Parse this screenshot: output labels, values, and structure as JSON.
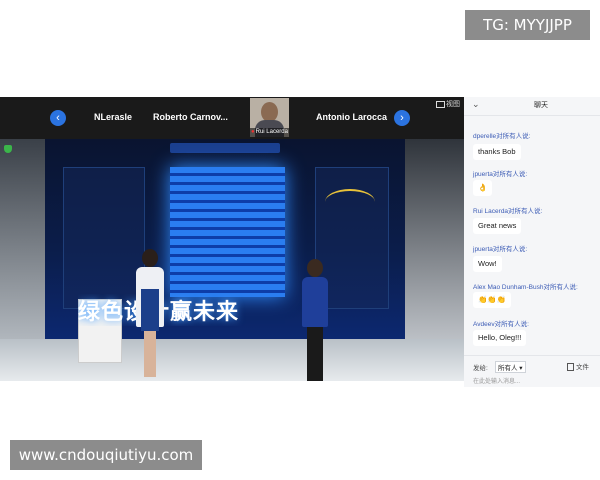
{
  "watermarks": {
    "top": "TG: MYYJJPP",
    "bottom": "www.cndouqiutiyu.com"
  },
  "participants": {
    "prev_icon": "chevron-left-icon",
    "next_icon": "chevron-right-icon",
    "names": [
      "NLerasle",
      "Roberto  Carnov...",
      "Antonio Larocca"
    ],
    "active_speaker": "Rui Lacerda",
    "view_label": "视图"
  },
  "presentation": {
    "slogan": "绿色设计赢未来"
  },
  "chat": {
    "title": "聊天",
    "messages": [
      {
        "sender": "dperelle对所有人说:",
        "text": "thanks Bob"
      },
      {
        "sender": "jpuerta对所有人说:",
        "text": "👌"
      },
      {
        "sender": "Rui Lacerda对所有人说:",
        "text": "Great news"
      },
      {
        "sender": "jpuerta对所有人说:",
        "text": "Wow!"
      },
      {
        "sender": "Alex Mao Dunham-Bush对所有人说:",
        "text": "👏👏👏"
      },
      {
        "sender": "Avdeev对所有人说:",
        "text": "Hello, Oleg!!!"
      }
    ],
    "send_to_label": "发给:",
    "recipient": "所有人 ▾",
    "file_label": "文件",
    "input_hint": "在此处输入消息..."
  },
  "colors": {
    "accent": "#2b73e0",
    "sender_text": "#3b5bb5"
  }
}
